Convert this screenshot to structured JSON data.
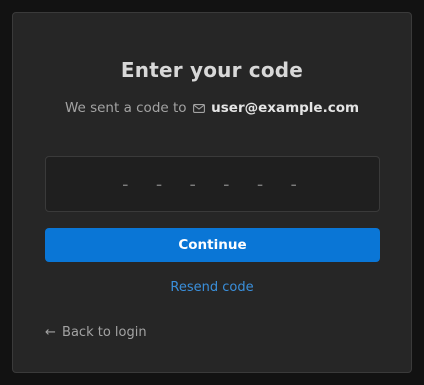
{
  "card": {
    "title": "Enter your code",
    "subtitle_prefix": "We sent a code to",
    "email": "user@example.com",
    "mail_icon": "mail-icon"
  },
  "code_input": {
    "value": "",
    "placeholder": "- - - - - -"
  },
  "continue_label": "Continue",
  "resend_label": "Resend code",
  "back": {
    "arrow": "←",
    "label": "Back to login"
  },
  "colors": {
    "background": "#121212",
    "card": "#262626",
    "accent": "#0a76d6",
    "link": "#3a8fdb"
  }
}
